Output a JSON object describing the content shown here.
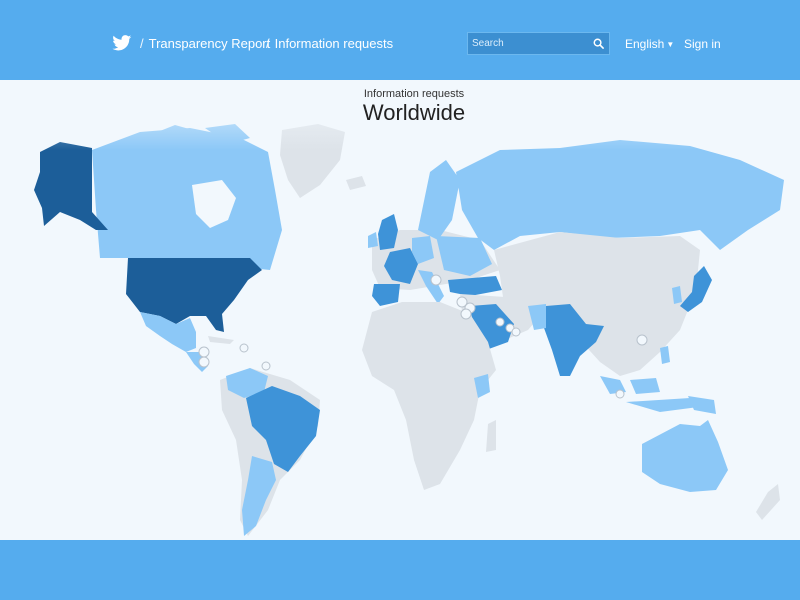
{
  "header": {
    "logo_icon": "twitter-bird-icon",
    "breadcrumb": [
      {
        "sep": "/",
        "label": "Transparency Report"
      },
      {
        "sep": "/",
        "label": "Information requests"
      }
    ],
    "search": {
      "placeholder": "Search",
      "icon": "search-icon"
    },
    "language": "English",
    "sign_in": "Sign in"
  },
  "map": {
    "subtitle": "Information requests",
    "title": "Worldwide",
    "colors": {
      "background": "#f2f8fd",
      "no_data": "#dde3e9",
      "level_1": "#8cc8f7",
      "level_2": "#3e93d8",
      "level_3": "#1c5e99"
    },
    "countries": [
      {
        "name": "United States",
        "level": 3
      },
      {
        "name": "Alaska",
        "level": 3
      },
      {
        "name": "Canada",
        "level": 1
      },
      {
        "name": "Mexico",
        "level": 1
      },
      {
        "name": "Brazil",
        "level": 2
      },
      {
        "name": "Argentina",
        "level": 1
      },
      {
        "name": "Colombia",
        "level": 1
      },
      {
        "name": "United Kingdom",
        "level": 2
      },
      {
        "name": "France",
        "level": 2
      },
      {
        "name": "Spain",
        "level": 2
      },
      {
        "name": "Germany",
        "level": 1
      },
      {
        "name": "Italy",
        "level": 1
      },
      {
        "name": "Turkey",
        "level": 2
      },
      {
        "name": "Russia",
        "level": 1
      },
      {
        "name": "Saudi Arabia",
        "level": 2
      },
      {
        "name": "India",
        "level": 2
      },
      {
        "name": "Japan",
        "level": 2
      },
      {
        "name": "Indonesia",
        "level": 1
      },
      {
        "name": "Australia",
        "level": 1
      },
      {
        "name": "Kenya",
        "level": 1
      }
    ]
  }
}
